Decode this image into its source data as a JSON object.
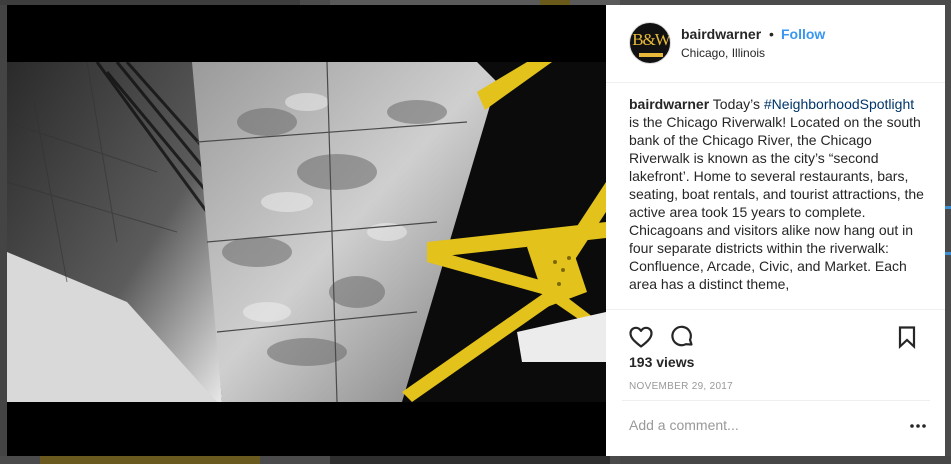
{
  "post": {
    "username": "bairdwarner",
    "separator": "•",
    "follow_label": "Follow",
    "location": "Chicago, Illinois",
    "avatar_text": "B&W"
  },
  "caption": {
    "username": "bairdwarner",
    "text_before": "Today’s",
    "hashtag": "#NeighborhoodSpotlight",
    "text_after": "is the Chicago Riverwalk! Located on the south bank of the Chicago River, the Chicago Riverwalk is known as the city’s “second lakefront’. Home to several restaurants, bars, seating, boat rentals, and tourist attractions, the active area took 15 years to complete. Chicagoans and visitors alike now hang out in four separate districts within the riverwalk: Confluence, Arcade, Civic, and Market. Each area has a distinct theme,"
  },
  "stats": {
    "views": "193 views",
    "date": "NOVEMBER 29, 2017"
  },
  "comment": {
    "placeholder": "Add a comment..."
  },
  "icons": {
    "like": "heart-icon",
    "comment": "comment-bubble-icon",
    "save": "bookmark-icon",
    "more": "more-options-icon"
  },
  "colors": {
    "link": "#3897f0",
    "hashtag": "#003569",
    "text": "#262626",
    "muted": "#999999",
    "beam_yellow": "#e3c21b"
  }
}
